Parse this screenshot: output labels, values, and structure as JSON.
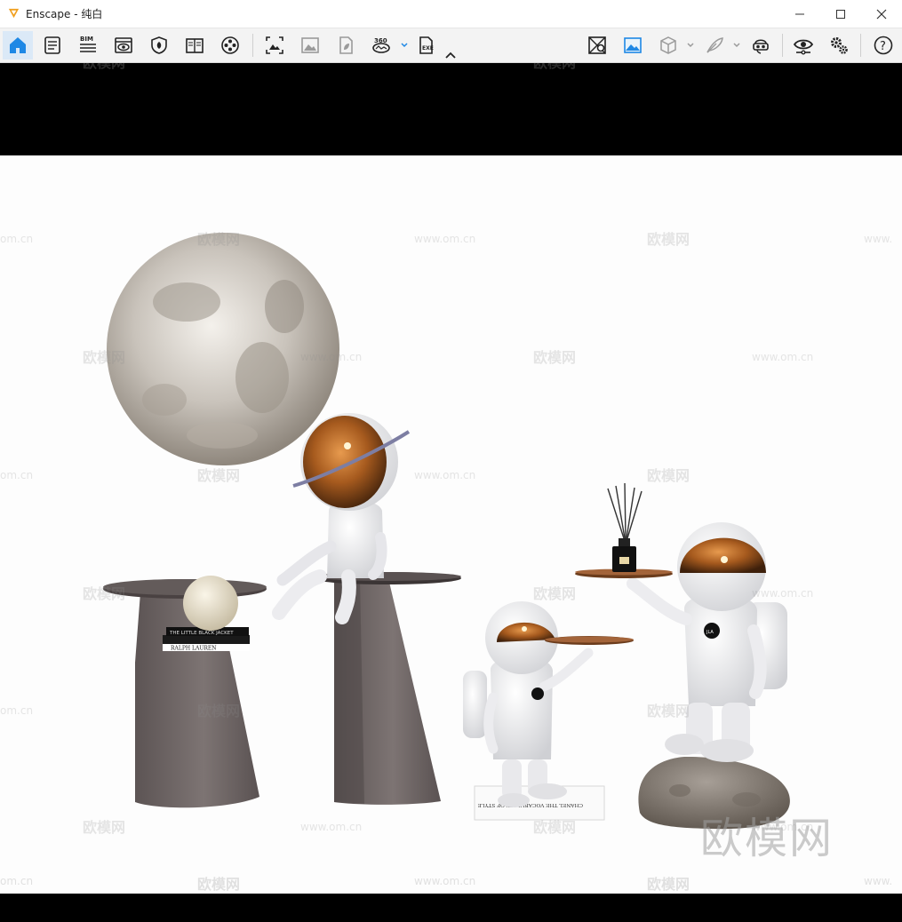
{
  "window": {
    "title": "Enscape - 纯白",
    "minimize": "—",
    "maximize": "☐",
    "close": "✕"
  },
  "toolbar": {
    "left_tools": [
      {
        "icon": "home-icon",
        "active": true
      },
      {
        "icon": "notes-icon"
      },
      {
        "icon": "bim-icon",
        "label": "BIM"
      },
      {
        "icon": "view-icon"
      },
      {
        "icon": "shield-icon"
      },
      {
        "icon": "book-icon"
      },
      {
        "icon": "film-reel-icon"
      },
      {
        "icon": "screenshot-icon"
      },
      {
        "icon": "image-icon"
      },
      {
        "icon": "file-leaf-icon"
      },
      {
        "icon": "panorama-360-icon",
        "label": "360"
      },
      {
        "icon": "export-icon",
        "label": "EXE"
      }
    ],
    "right_tools": [
      {
        "icon": "map-pin-icon"
      },
      {
        "icon": "landscape-icon"
      },
      {
        "icon": "cube-icon"
      },
      {
        "icon": "feather-icon"
      },
      {
        "icon": "vr-headset-icon"
      },
      {
        "icon": "eye-settings-icon"
      },
      {
        "icon": "gears-icon"
      },
      {
        "icon": "help-icon",
        "label": "?"
      }
    ]
  },
  "scene": {
    "book_top_text": "THE LITTLE BLACK JACKET",
    "book_bottom_text": "RALPH LAUREN",
    "book_floor_text": "CHANEL THE VOCABULARY OF STYLE",
    "badge_text": "JLA",
    "watermark_brand": "欧模网",
    "watermark_url": "www.om.cn",
    "watermark_url_partial": "om.cn",
    "watermark_url_cut": "www."
  }
}
